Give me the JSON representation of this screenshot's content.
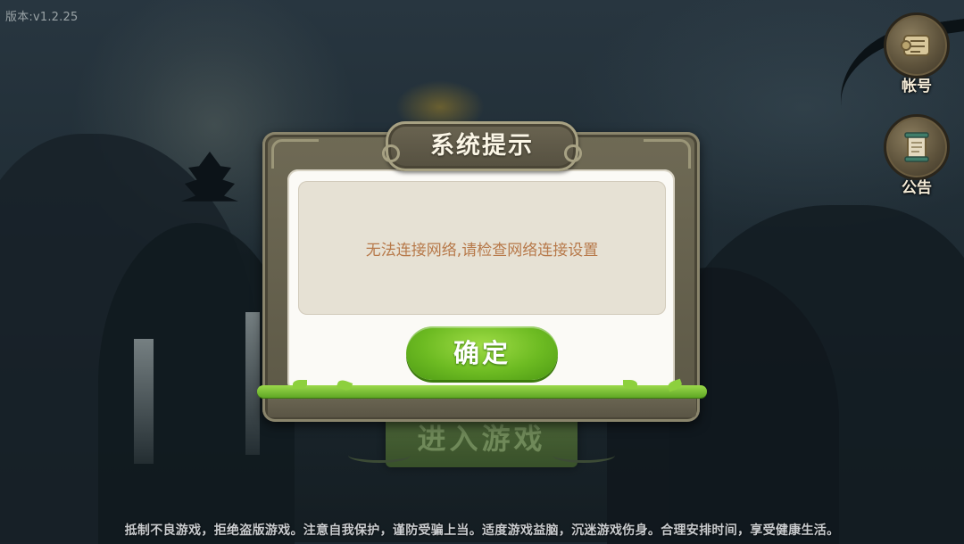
{
  "version_label": "版本:v1.2.25",
  "side_buttons": {
    "account": {
      "label": "帐号",
      "icon": "account-scroll-icon"
    },
    "notice": {
      "label": "公告",
      "icon": "notice-scroll-icon"
    }
  },
  "enter_game_label": "进入游戏",
  "dialog": {
    "title": "系统提示",
    "message": "无法连接网络,请检查网络连接设置",
    "confirm_label": "确定"
  },
  "footer_notice": "抵制不良游戏，拒绝盗版游戏。注意自我保护，谨防受骗上当。适度游戏益脑，沉迷游戏伤身。合理安排时间，享受健康生活。",
  "colors": {
    "confirm_green": "#6dbb22",
    "message_text": "#b7794a",
    "frame": "#5c5846"
  }
}
